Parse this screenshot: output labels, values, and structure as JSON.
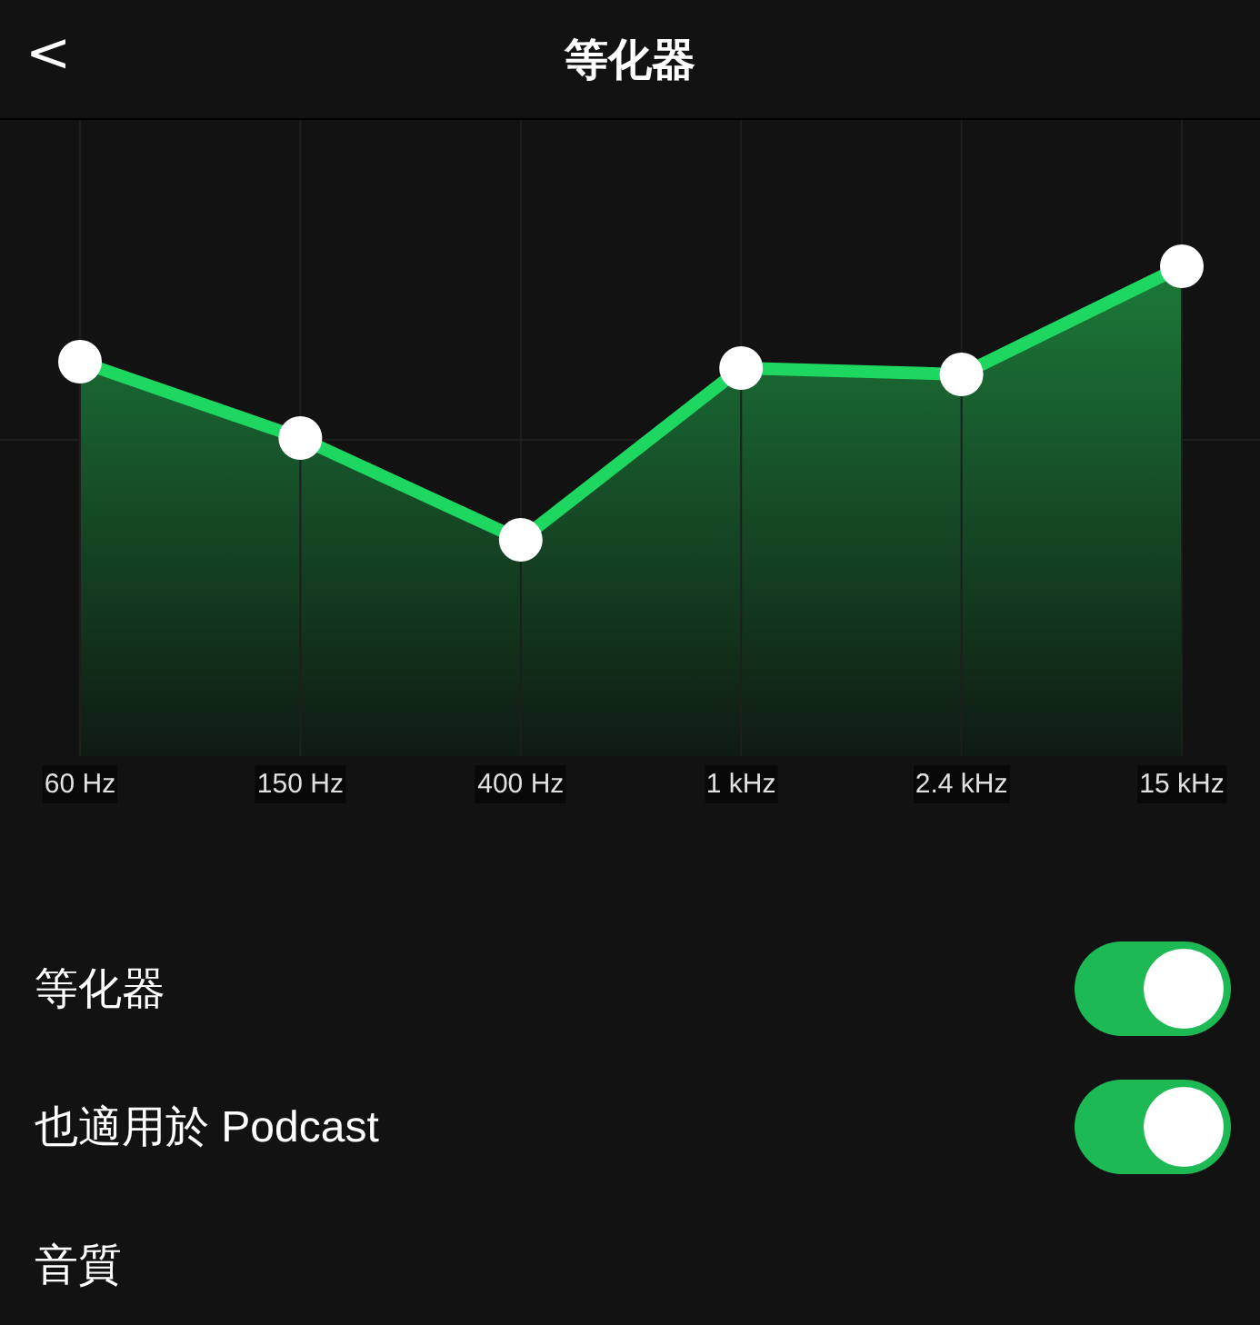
{
  "header": {
    "back": "<",
    "title": "等化器"
  },
  "bands": [
    {
      "label": "60 Hz",
      "level": 0.62
    },
    {
      "label": "150 Hz",
      "level": 0.5
    },
    {
      "label": "400 Hz",
      "level": 0.34
    },
    {
      "label": "1 kHz",
      "level": 0.61
    },
    {
      "label": "2.4 kHz",
      "level": 0.6
    },
    {
      "label": "15 kHz",
      "level": 0.77
    }
  ],
  "settings": [
    {
      "kind": "toggle",
      "label": "等化器",
      "on": true
    },
    {
      "kind": "toggle",
      "label": "也適用於 Podcast",
      "on": true
    },
    {
      "kind": "link",
      "label": "音質"
    }
  ]
}
